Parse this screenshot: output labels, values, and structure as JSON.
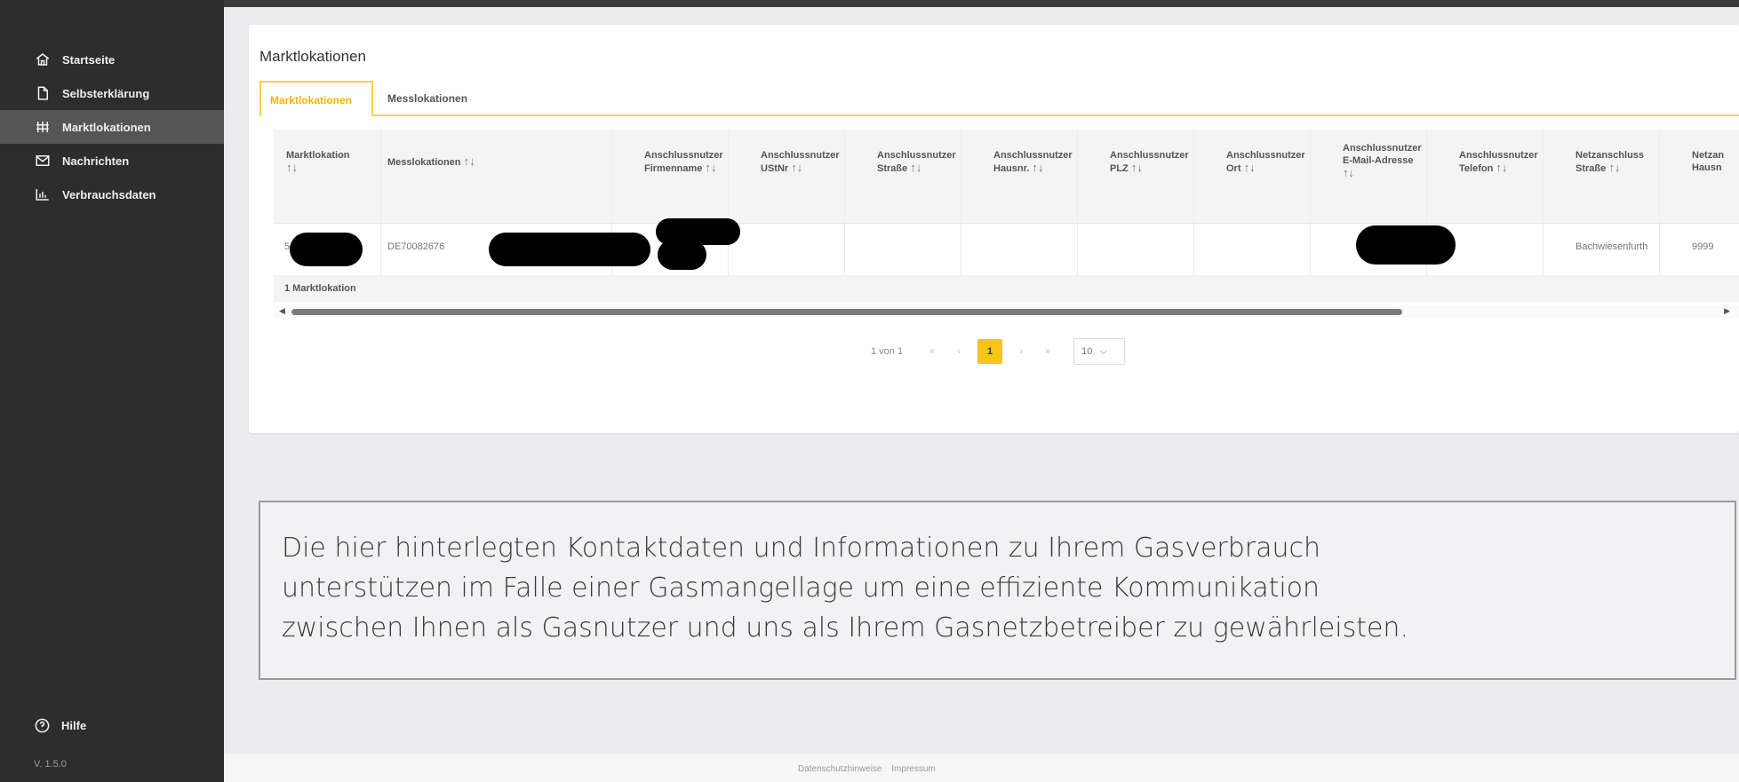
{
  "sidebar": {
    "items": [
      {
        "label": "Startseite",
        "icon": "home-icon"
      },
      {
        "label": "Selbsterklärung",
        "icon": "document-icon"
      },
      {
        "label": "Marktlokationen",
        "icon": "grid-icon",
        "active": true
      },
      {
        "label": "Nachrichten",
        "icon": "mail-icon"
      },
      {
        "label": "Verbrauchsdaten",
        "icon": "chart-icon"
      }
    ],
    "help_label": "Hilfe",
    "version": "V. 1.5.0"
  },
  "card": {
    "title": "Marktlokationen",
    "tabs": [
      {
        "label": "Marktlokationen",
        "active": true
      },
      {
        "label": "Messlokationen"
      }
    ]
  },
  "table": {
    "sort_glyph": "↑↓",
    "columns": [
      {
        "line1": "Marktlokation",
        "line2": ""
      },
      {
        "line1": "Messlokationen",
        "line2": ""
      },
      {
        "line1": "Anschlussnutzer",
        "line2": "Firmenname"
      },
      {
        "line1": "Anschlussnutzer",
        "line2": "UStNr"
      },
      {
        "line1": "Anschlussnutzer",
        "line2": "Straße"
      },
      {
        "line1": "Anschlussnutzer",
        "line2": "Hausnr."
      },
      {
        "line1": "Anschlussnutzer",
        "line2": "PLZ"
      },
      {
        "line1": "Anschlussnutzer",
        "line2": "Ort"
      },
      {
        "line1": "Anschlussnutzer",
        "line2": "E-Mail-Adresse"
      },
      {
        "line1": "Anschlussnutzer",
        "line2": "Telefon"
      },
      {
        "line1": "Netzanschluss",
        "line2": "Straße"
      },
      {
        "line1": "Netzan",
        "line2": "Hausn"
      }
    ],
    "row": {
      "marktlokation": "5",
      "messlokation": "DE70082676",
      "netzanschluss_strasse": "Bachwiesenfurth",
      "netzanschluss_hausnr": "9999"
    },
    "footer": "1 Marktlokation"
  },
  "pager": {
    "info": "1 von 1",
    "first": "«",
    "prev": "‹",
    "current": "1",
    "next": "›",
    "last": "»",
    "page_size": "10"
  },
  "info_box": {
    "line1": "Die hier hinterlegten Kontaktdaten und Informationen zu Ihrem Gasverbrauch",
    "line2": "unterstützen im Falle einer Gasmangellage um eine effiziente Kommunikation",
    "line3": "zwischen Ihnen als Gasnutzer und uns als Ihrem Gasnetzbetreiber zu gewährleisten."
  },
  "footer": {
    "links": [
      "Datenschutzhinweise",
      "Impressum"
    ]
  },
  "colors": {
    "accent": "#f5c518",
    "sidebar_bg": "#2d2d2d",
    "active_item_bg": "#555555"
  }
}
